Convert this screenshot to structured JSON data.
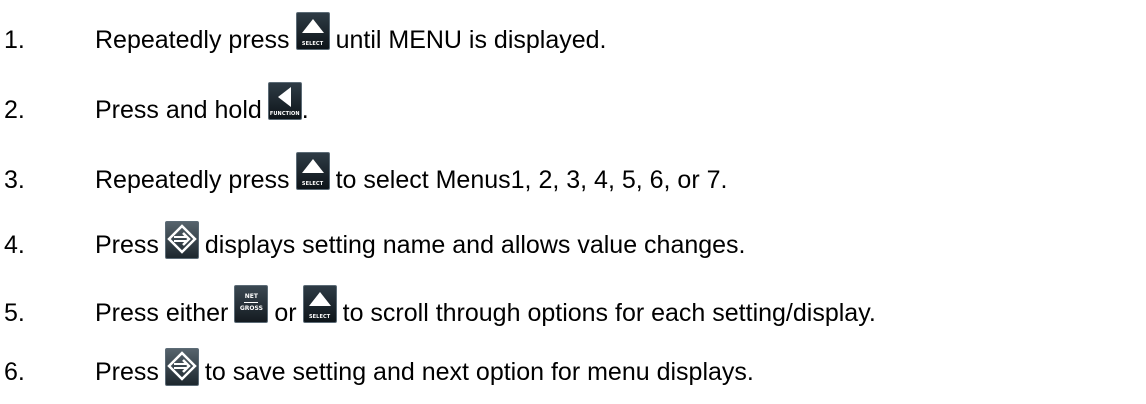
{
  "steps": [
    {
      "number": "1.",
      "before": "Repeatedly press",
      "after": "until MENU is displayed."
    },
    {
      "number": "2.",
      "before": "Press and hold",
      "after": "."
    },
    {
      "number": "3.",
      "before": "Repeatedly press",
      "after": "to select Menus1, 2, 3, 4, 5, 6, or 7."
    },
    {
      "number": "4.",
      "before": "Press",
      "after": "displays setting name and allows value changes."
    },
    {
      "number": "5.",
      "before": "Press either",
      "middle": "or",
      "after": "to scroll through options for each setting/display."
    },
    {
      "number": "6.",
      "before": "Press",
      "after": "to save setting and next option for menu displays."
    }
  ],
  "buttons": {
    "select": {
      "icon": "select-button-icon",
      "caption": "SELECT"
    },
    "function": {
      "icon": "function-button-icon",
      "caption": "FUNCTION"
    },
    "enter": {
      "icon": "enter-arrow-icon"
    },
    "net_gross": {
      "icon": "net-gross-button-icon",
      "top": "NET",
      "bottom": "GROSS"
    }
  },
  "colors": {
    "text": "#000000",
    "button_dark": "#0d1419",
    "button_face": "#2e3b45"
  }
}
